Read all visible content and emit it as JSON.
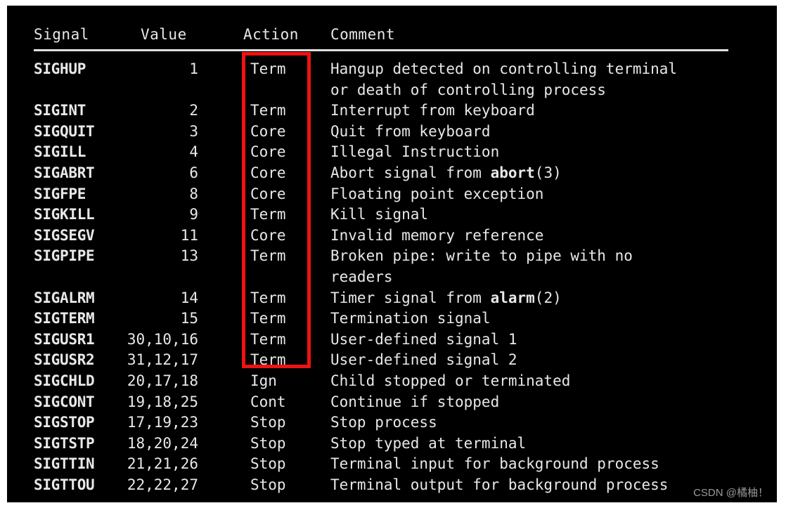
{
  "page": {
    "background_color": "#ffffff",
    "terminal_background": "#000000",
    "text_color": "#e8e8e8",
    "annotation_color": "#ef1212"
  },
  "table": {
    "headers": [
      "Signal",
      "Value",
      "Action",
      "Comment"
    ],
    "rows": [
      {
        "signal": "SIGHUP",
        "value": "1",
        "action": "Term",
        "comment": "Hangup detected on controlling terminal",
        "comment_cont": "or death of controlling process",
        "bold_token": ""
      },
      {
        "signal": "SIGINT",
        "value": "2",
        "action": "Term",
        "comment": "Interrupt from keyboard",
        "comment_cont": "",
        "bold_token": ""
      },
      {
        "signal": "SIGQUIT",
        "value": "3",
        "action": "Core",
        "comment": "Quit from keyboard",
        "comment_cont": "",
        "bold_token": ""
      },
      {
        "signal": "SIGILL",
        "value": "4",
        "action": "Core",
        "comment": "Illegal Instruction",
        "comment_cont": "",
        "bold_token": ""
      },
      {
        "signal": "SIGABRT",
        "value": "6",
        "action": "Core",
        "comment_pre": "Abort signal from ",
        "bold_token": "abort",
        "comment_post": "(3)",
        "comment": "Abort signal from abort(3)",
        "comment_cont": ""
      },
      {
        "signal": "SIGFPE",
        "value": "8",
        "action": "Core",
        "comment": "Floating point exception",
        "comment_cont": "",
        "bold_token": ""
      },
      {
        "signal": "SIGKILL",
        "value": "9",
        "action": "Term",
        "comment": "Kill signal",
        "comment_cont": "",
        "bold_token": ""
      },
      {
        "signal": "SIGSEGV",
        "value": "11",
        "action": "Core",
        "comment": "Invalid memory reference",
        "comment_cont": "",
        "bold_token": ""
      },
      {
        "signal": "SIGPIPE",
        "value": "13",
        "action": "Term",
        "comment": "Broken pipe: write to pipe with no",
        "comment_cont": "readers",
        "bold_token": ""
      },
      {
        "signal": "SIGALRM",
        "value": "14",
        "action": "Term",
        "comment_pre": "Timer signal from ",
        "bold_token": "alarm",
        "comment_post": "(2)",
        "comment": "Timer signal from alarm(2)",
        "comment_cont": ""
      },
      {
        "signal": "SIGTERM",
        "value": "15",
        "action": "Term",
        "comment": "Termination signal",
        "comment_cont": "",
        "bold_token": ""
      },
      {
        "signal": "SIGUSR1",
        "value": "30,10,16",
        "action": "Term",
        "comment": "User-defined signal 1",
        "comment_cont": "",
        "bold_token": ""
      },
      {
        "signal": "SIGUSR2",
        "value": "31,12,17",
        "action": "Term",
        "comment": "User-defined signal 2",
        "comment_cont": "",
        "bold_token": ""
      },
      {
        "signal": "SIGCHLD",
        "value": "20,17,18",
        "action": "Ign",
        "comment": "Child stopped or terminated",
        "comment_cont": "",
        "bold_token": ""
      },
      {
        "signal": "SIGCONT",
        "value": "19,18,25",
        "action": "Cont",
        "comment": "Continue if stopped",
        "comment_cont": "",
        "bold_token": ""
      },
      {
        "signal": "SIGSTOP",
        "value": "17,19,23",
        "action": "Stop",
        "comment": "Stop process",
        "comment_cont": "",
        "bold_token": ""
      },
      {
        "signal": "SIGTSTP",
        "value": "18,20,24",
        "action": "Stop",
        "comment": "Stop typed at terminal",
        "comment_cont": "",
        "bold_token": ""
      },
      {
        "signal": "SIGTTIN",
        "value": "21,21,26",
        "action": "Stop",
        "comment": "Terminal input for background process",
        "comment_cont": "",
        "bold_token": ""
      },
      {
        "signal": "SIGTTOU",
        "value": "22,22,27",
        "action": "Stop",
        "comment": "Terminal output for background process",
        "comment_cont": "",
        "bold_token": ""
      }
    ]
  },
  "annotation": {
    "label": "red-highlight-rectangle",
    "covers_column": "Action",
    "covers_from": "SIGHUP",
    "covers_to": "SIGUSR2"
  },
  "watermark": {
    "text": "CSDN @橘柚！"
  }
}
